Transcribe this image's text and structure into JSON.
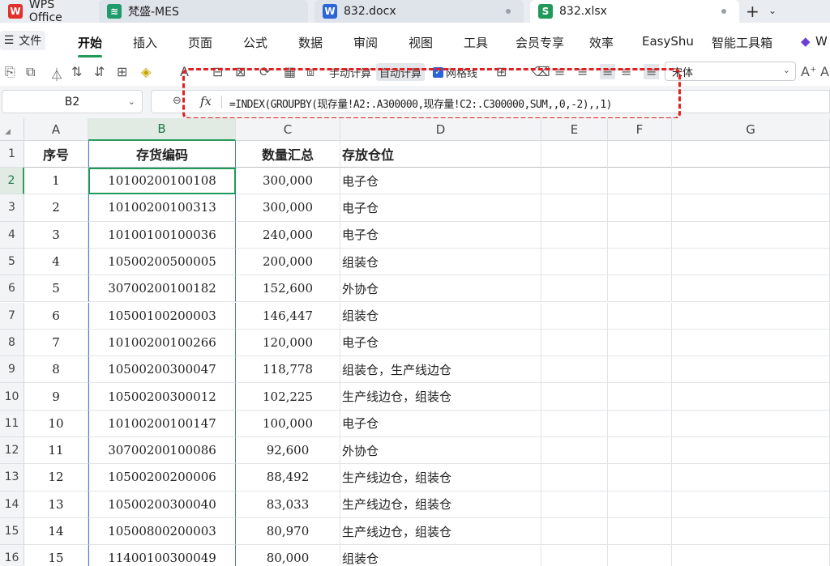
{
  "tabs": [
    {
      "label": "WPS Office",
      "icon": "wps-logo-icon",
      "color": "#e0312b"
    },
    {
      "label": "梵盛-MES",
      "icon": "mes-app-icon",
      "color": "#1f9a6a"
    },
    {
      "label": "832.docx",
      "icon": "word-doc-icon",
      "color": "#2b66d9"
    },
    {
      "label": "832.xlsx",
      "icon": "sheet-doc-icon",
      "color": "#1f9a5a"
    }
  ],
  "menu": {
    "file": "文件",
    "items": [
      "开始",
      "插入",
      "页面",
      "公式",
      "数据",
      "审阅",
      "视图",
      "工具",
      "会员专享",
      "效率",
      "EasyShu",
      "智能工具箱"
    ],
    "cut_label": "W"
  },
  "toolbar": {
    "manual_calc": "手动计算",
    "auto_calc": "自动计算",
    "gridlines": "网格线",
    "font_name": "宋体"
  },
  "formula_bar": {
    "cell_ref": "B2",
    "fx": "fx",
    "formula": "=INDEX(GROUPBY(现存量!A2:.A300000,现存量!C2:.C300000,SUM,,0,-2),,1)"
  },
  "grid": {
    "columns": [
      "A",
      "B",
      "C",
      "D",
      "E",
      "F",
      "G"
    ],
    "selected_column": "B",
    "selected_row": "2",
    "headers": [
      "序号",
      "存货编码",
      "数量汇总",
      "存放仓位"
    ],
    "rows": [
      {
        "n": "2",
        "a": "1",
        "b": "10100200100108",
        "c": "300,000",
        "d": "电子仓"
      },
      {
        "n": "3",
        "a": "2",
        "b": "10100200100313",
        "c": "300,000",
        "d": "电子仓"
      },
      {
        "n": "4",
        "a": "3",
        "b": "10100100100036",
        "c": "240,000",
        "d": "电子仓"
      },
      {
        "n": "5",
        "a": "4",
        "b": "10500200500005",
        "c": "200,000",
        "d": "组装仓"
      },
      {
        "n": "6",
        "a": "5",
        "b": "30700200100182",
        "c": "152,600",
        "d": "外协仓"
      },
      {
        "n": "7",
        "a": "6",
        "b": "10500100200003",
        "c": "146,447",
        "d": "组装仓"
      },
      {
        "n": "8",
        "a": "7",
        "b": "10100200100266",
        "c": "120,000",
        "d": "电子仓"
      },
      {
        "n": "9",
        "a": "8",
        "b": "10500200300047",
        "c": "118,778",
        "d": "组装仓，生产线边仓"
      },
      {
        "n": "10",
        "a": "9",
        "b": "10500200300012",
        "c": "102,225",
        "d": "生产线边仓，组装仓"
      },
      {
        "n": "11",
        "a": "10",
        "b": "10100200100147",
        "c": "100,000",
        "d": "电子仓"
      },
      {
        "n": "12",
        "a": "11",
        "b": "30700200100086",
        "c": "92,600",
        "d": "外协仓"
      },
      {
        "n": "13",
        "a": "12",
        "b": "10500200200006",
        "c": "88,492",
        "d": "生产线边仓，组装仓"
      },
      {
        "n": "14",
        "a": "13",
        "b": "10500200300040",
        "c": "83,033",
        "d": "生产线边仓，组装仓"
      },
      {
        "n": "15",
        "a": "14",
        "b": "10500800200003",
        "c": "80,970",
        "d": "生产线边仓，组装仓"
      },
      {
        "n": "16",
        "a": "15",
        "b": "11400100300049",
        "c": "80,000",
        "d": "组装仓"
      }
    ]
  }
}
